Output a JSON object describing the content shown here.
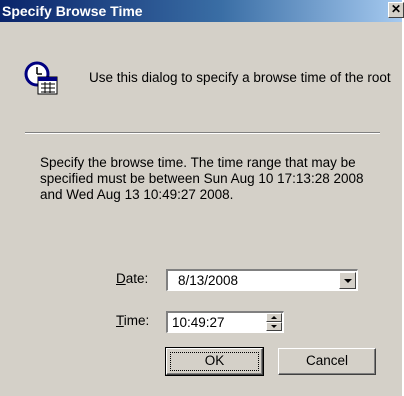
{
  "window": {
    "title": "Specify Browse Time",
    "close_glyph": "✕"
  },
  "intro": {
    "icon": "clock-calendar-icon",
    "text": "Use this dialog to specify a browse time of the root"
  },
  "description": "Specify the browse time.  The time range that may be specified must be between Sun Aug 10 17:13:28 2008 and Wed Aug 13 10:49:27 2008.",
  "form": {
    "date_label_accel": "D",
    "date_label_rest": "ate:",
    "date_value": "8/13/2008",
    "time_label_accel": "T",
    "time_label_rest": "ime:",
    "time_value": "10:49:27"
  },
  "buttons": {
    "ok_label": "OK",
    "cancel_label": "Cancel"
  },
  "colors": {
    "titlebar_start": "#0a246a",
    "titlebar_end": "#a6caf0",
    "dialog_face": "#d4d0c8"
  }
}
